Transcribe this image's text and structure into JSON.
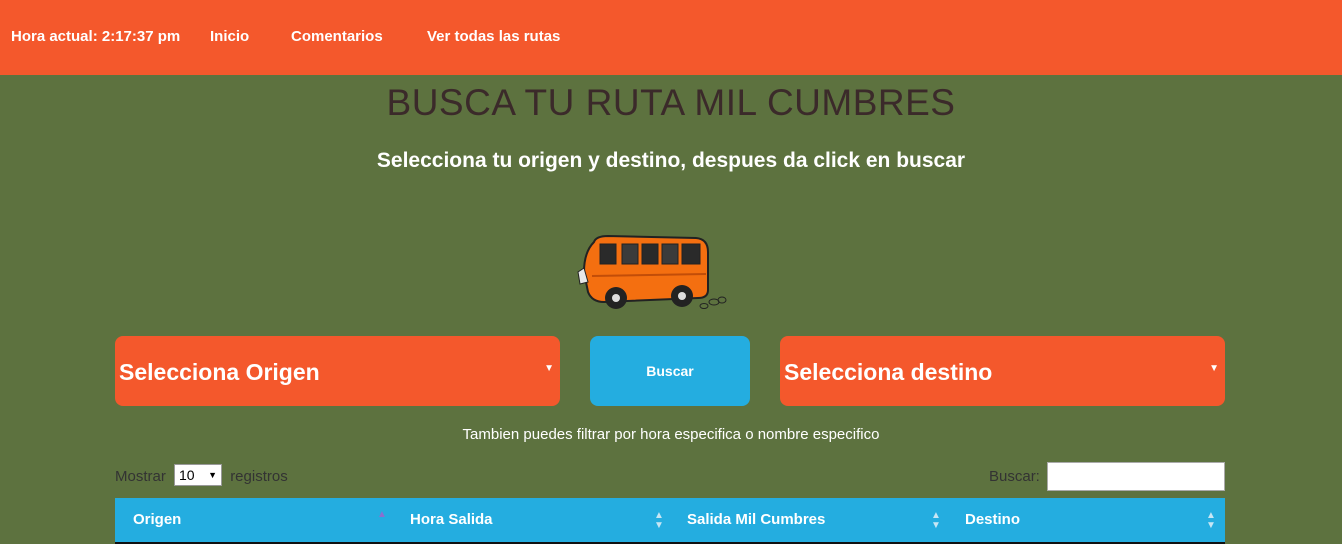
{
  "header": {
    "clock": "Hora actual: 2:17:37 pm",
    "nav": [
      "Inicio",
      "Comentarios",
      "Ver todas las rutas"
    ]
  },
  "main": {
    "title": "BUSCA TU RUTA MIL CUMBRES",
    "subtitle": "Selecciona tu origen y destino, despues da click en buscar",
    "origin_select": "Selecciona Origen",
    "search_button": "Buscar",
    "destination_select": "Selecciona destino",
    "hint": "Tambien puedes filtrar por hora especifica o nombre especifico"
  },
  "table_controls": {
    "show_label": "Mostrar",
    "length_value": "10",
    "records_label": "registros",
    "search_label": "Buscar:",
    "search_value": ""
  },
  "table": {
    "columns": [
      "Origen",
      "Hora Salida",
      "Salida Mil Cumbres",
      "Destino"
    ]
  },
  "icons": {
    "select_arrow": "caret-down-icon",
    "sort": "sort-icon",
    "bus": "bus-illustration"
  },
  "colors": {
    "header_bg": "#f4582c",
    "page_bg": "#5d723f",
    "button_bg": "#24ade0",
    "table_header_bg": "#24ade0"
  }
}
